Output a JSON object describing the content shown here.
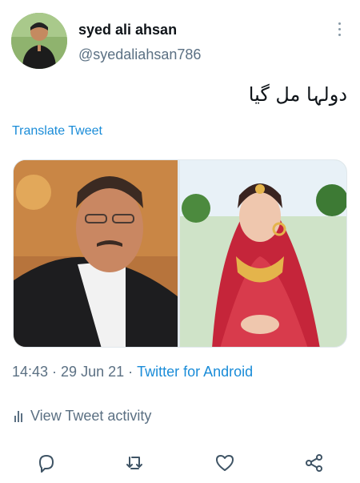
{
  "author": {
    "display_name": "syed ali ahsan",
    "handle": "@syedaliahsan786"
  },
  "tweet": {
    "text": "دولہا مل گیا",
    "translate_label": "Translate Tweet"
  },
  "meta": {
    "time": "14:43",
    "separator": "·",
    "date": "29 Jun 21",
    "client": "Twitter for Android"
  },
  "activity": {
    "label": "View Tweet activity"
  },
  "icons": {
    "more": "more-vertical-icon",
    "reply": "reply-icon",
    "retweet": "retweet-icon",
    "like": "like-icon",
    "share": "share-icon",
    "activity": "activity-bars-icon"
  },
  "colors": {
    "link": "#1a8cd8",
    "secondary_text": "#5b7083",
    "primary_text": "#0f1419"
  }
}
